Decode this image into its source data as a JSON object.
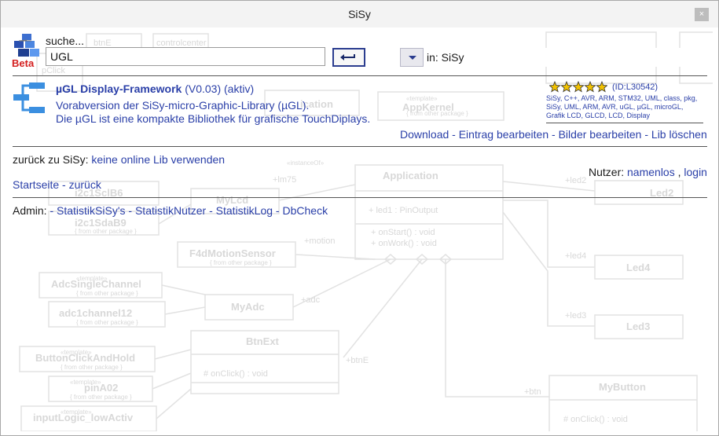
{
  "window": {
    "title": "SiSy",
    "close": "×"
  },
  "logo": {
    "badge": "Beta"
  },
  "search": {
    "label": "suche...",
    "value": "UGL",
    "scope": "in: SiSy"
  },
  "result": {
    "title": "µGL Display-Framework",
    "version": "(V0.03)",
    "status": "(aktiv)",
    "desc1": "Vorabversion der SiSy-micro-Graphic-Library (µGL).",
    "desc2": "Die µGL ist eine kompakte Bibliothek für grafische TouchDiplays.",
    "id": "(ID:L30542)",
    "rating": 5,
    "tags": "SiSy, C++, AVR, ARM, STM32, UML, class, pkg, SiSy, UML, ARM, AVR, uGL, µGL, microGL, Grafik LCD, GLCD, LCD, Display"
  },
  "actions": {
    "download": "Download",
    "edit": "Eintrag bearbeiten",
    "images": "Bilder bearbeiten",
    "delete": "Lib löschen",
    "sep": " - "
  },
  "back": {
    "prefix": "zurück zu SiSy:",
    "link": "keine online Lib verwenden"
  },
  "user": {
    "label": "Nutzer:",
    "name": "namenlos",
    "sep": ",",
    "login": "login"
  },
  "nav": {
    "home": "Startseite",
    "sep": " - ",
    "back": "zurück"
  },
  "admin": {
    "label": "Admin:",
    "sep": " - ",
    "links": [
      "StatistikSiSy's",
      "StatistikNutzer",
      "StatistikLog",
      "DbCheck"
    ]
  },
  "diagram": {
    "classes": {
      "application": "Application",
      "led1_attr": "+ led1 : PinOutput",
      "on_start": "+ onStart() : void",
      "on_work": "+ onWork() : void",
      "led2": "Led2",
      "led4": "Led4",
      "led3": "Led3",
      "my_button": "MyButton",
      "my_button_op": "# onClick() : void",
      "btnext": "BtnExt",
      "btnext_op": "# onClick() : void",
      "myadc": "MyAdc",
      "f4d": "F4dMotionSensor",
      "adcsingle": "AdcSingleChannel",
      "adc1ch": "adc1channel12",
      "bcah": "ButtonClickAndHold",
      "pina02": "pinA02",
      "inputlogic": "inputLogic_lowActiv",
      "i2c1scl": "i2c1SclB6",
      "i2c1sda": "i2c1SdaB9",
      "mylcd": "MyLcd",
      "appkernel": "AppKernel",
      "stereotype_template": "«template»",
      "stereotype_instance": "«instanceOf»",
      "btne": "btnE",
      "controlcenter": "controlcenter",
      "pclick": "pClick",
      "from_other": "{ from other package }",
      "app_frag": "ication"
    },
    "labels": {
      "lm75": "+lm75",
      "motion": "+motion",
      "adc": "+adc",
      "btne": "+btnE",
      "btn": "+btn",
      "led2": "+led2",
      "led4": "+led4",
      "led3": "+led3"
    }
  }
}
